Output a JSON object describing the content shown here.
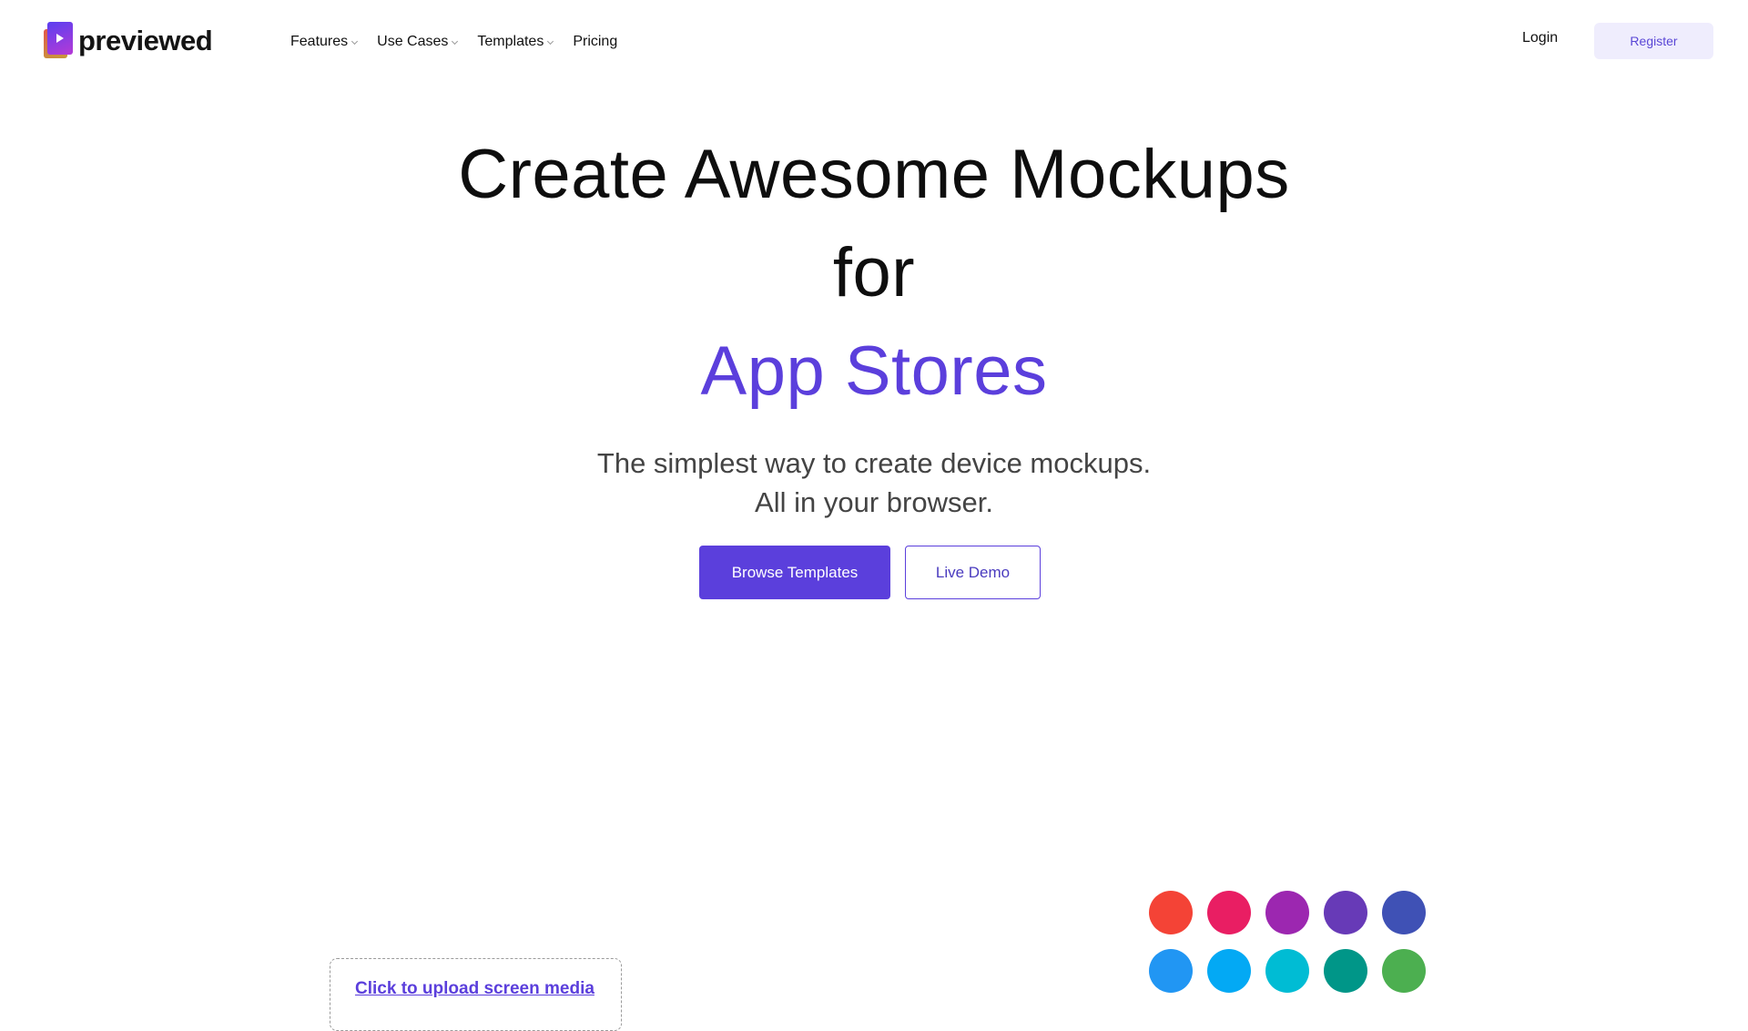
{
  "brand": {
    "name": "previewed",
    "logo_icon": "previewed-logo-icon"
  },
  "nav": {
    "items": [
      {
        "label": "Features",
        "dropdown": true
      },
      {
        "label": "Use Cases",
        "dropdown": true
      },
      {
        "label": "Templates",
        "dropdown": true
      },
      {
        "label": "Pricing",
        "dropdown": false
      }
    ],
    "login_label": "Login",
    "register_label": "Register"
  },
  "hero": {
    "line1": "Create Awesome Mockups",
    "line2": "for",
    "line3": "App Stores",
    "subtitle_line1": "The simplest way to create device mockups.",
    "subtitle_line2": "All in your browser.",
    "primary_cta": "Browse Templates",
    "secondary_cta": "Live Demo"
  },
  "editor": {
    "upload_label": "Click to upload screen media",
    "swatches": [
      "#f44336",
      "#e91e63",
      "#9c27b0",
      "#673ab7",
      "#3f51b5",
      "#2196f3",
      "#03a9f4",
      "#00bcd4",
      "#009688",
      "#4caf50"
    ]
  },
  "colors": {
    "accent": "#5b3fdc",
    "register_bg": "#efedfd",
    "register_text": "#5a47d6",
    "text": "#111111"
  }
}
